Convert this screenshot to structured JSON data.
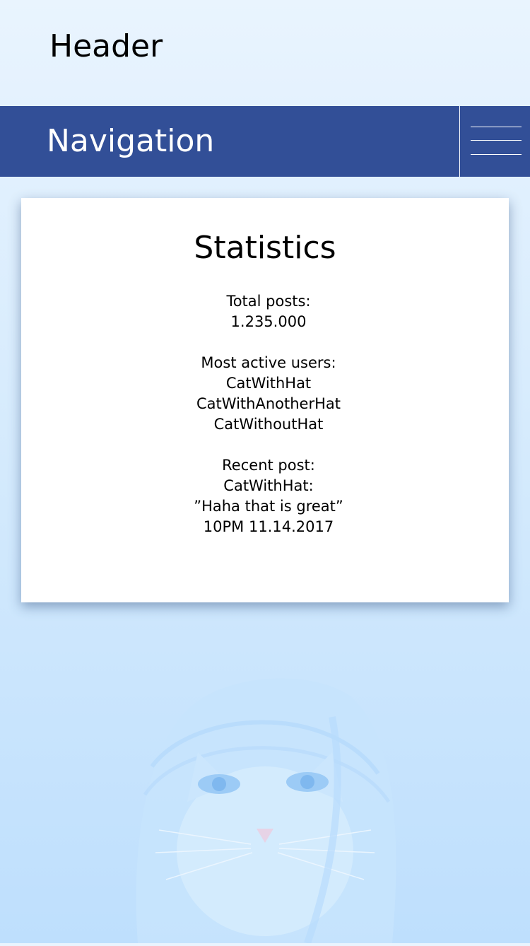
{
  "header": {
    "title": "Header"
  },
  "navigation": {
    "title": "Navigation",
    "menu_icon": "hamburger-menu-icon"
  },
  "statistics": {
    "title": "Statistics",
    "total_posts_label": "Total posts:",
    "total_posts_value": "1.235.000",
    "most_active_label": "Most active users:",
    "most_active_users": [
      "CatWithHat",
      "CatWithAnotherHat",
      "CatWithoutHat"
    ],
    "recent_post_label": "Recent post:",
    "recent_post_author": "CatWithHat:",
    "recent_post_text": "”Haha that is great”",
    "recent_post_time": "10PM 11.14.2017"
  },
  "colors": {
    "nav_background": "#324f97",
    "card_background": "#ffffff",
    "page_background_top": "#e9f4fe",
    "page_background_bottom": "#bedffd"
  },
  "background_image": {
    "icon": "cat-with-hat-illustration"
  }
}
